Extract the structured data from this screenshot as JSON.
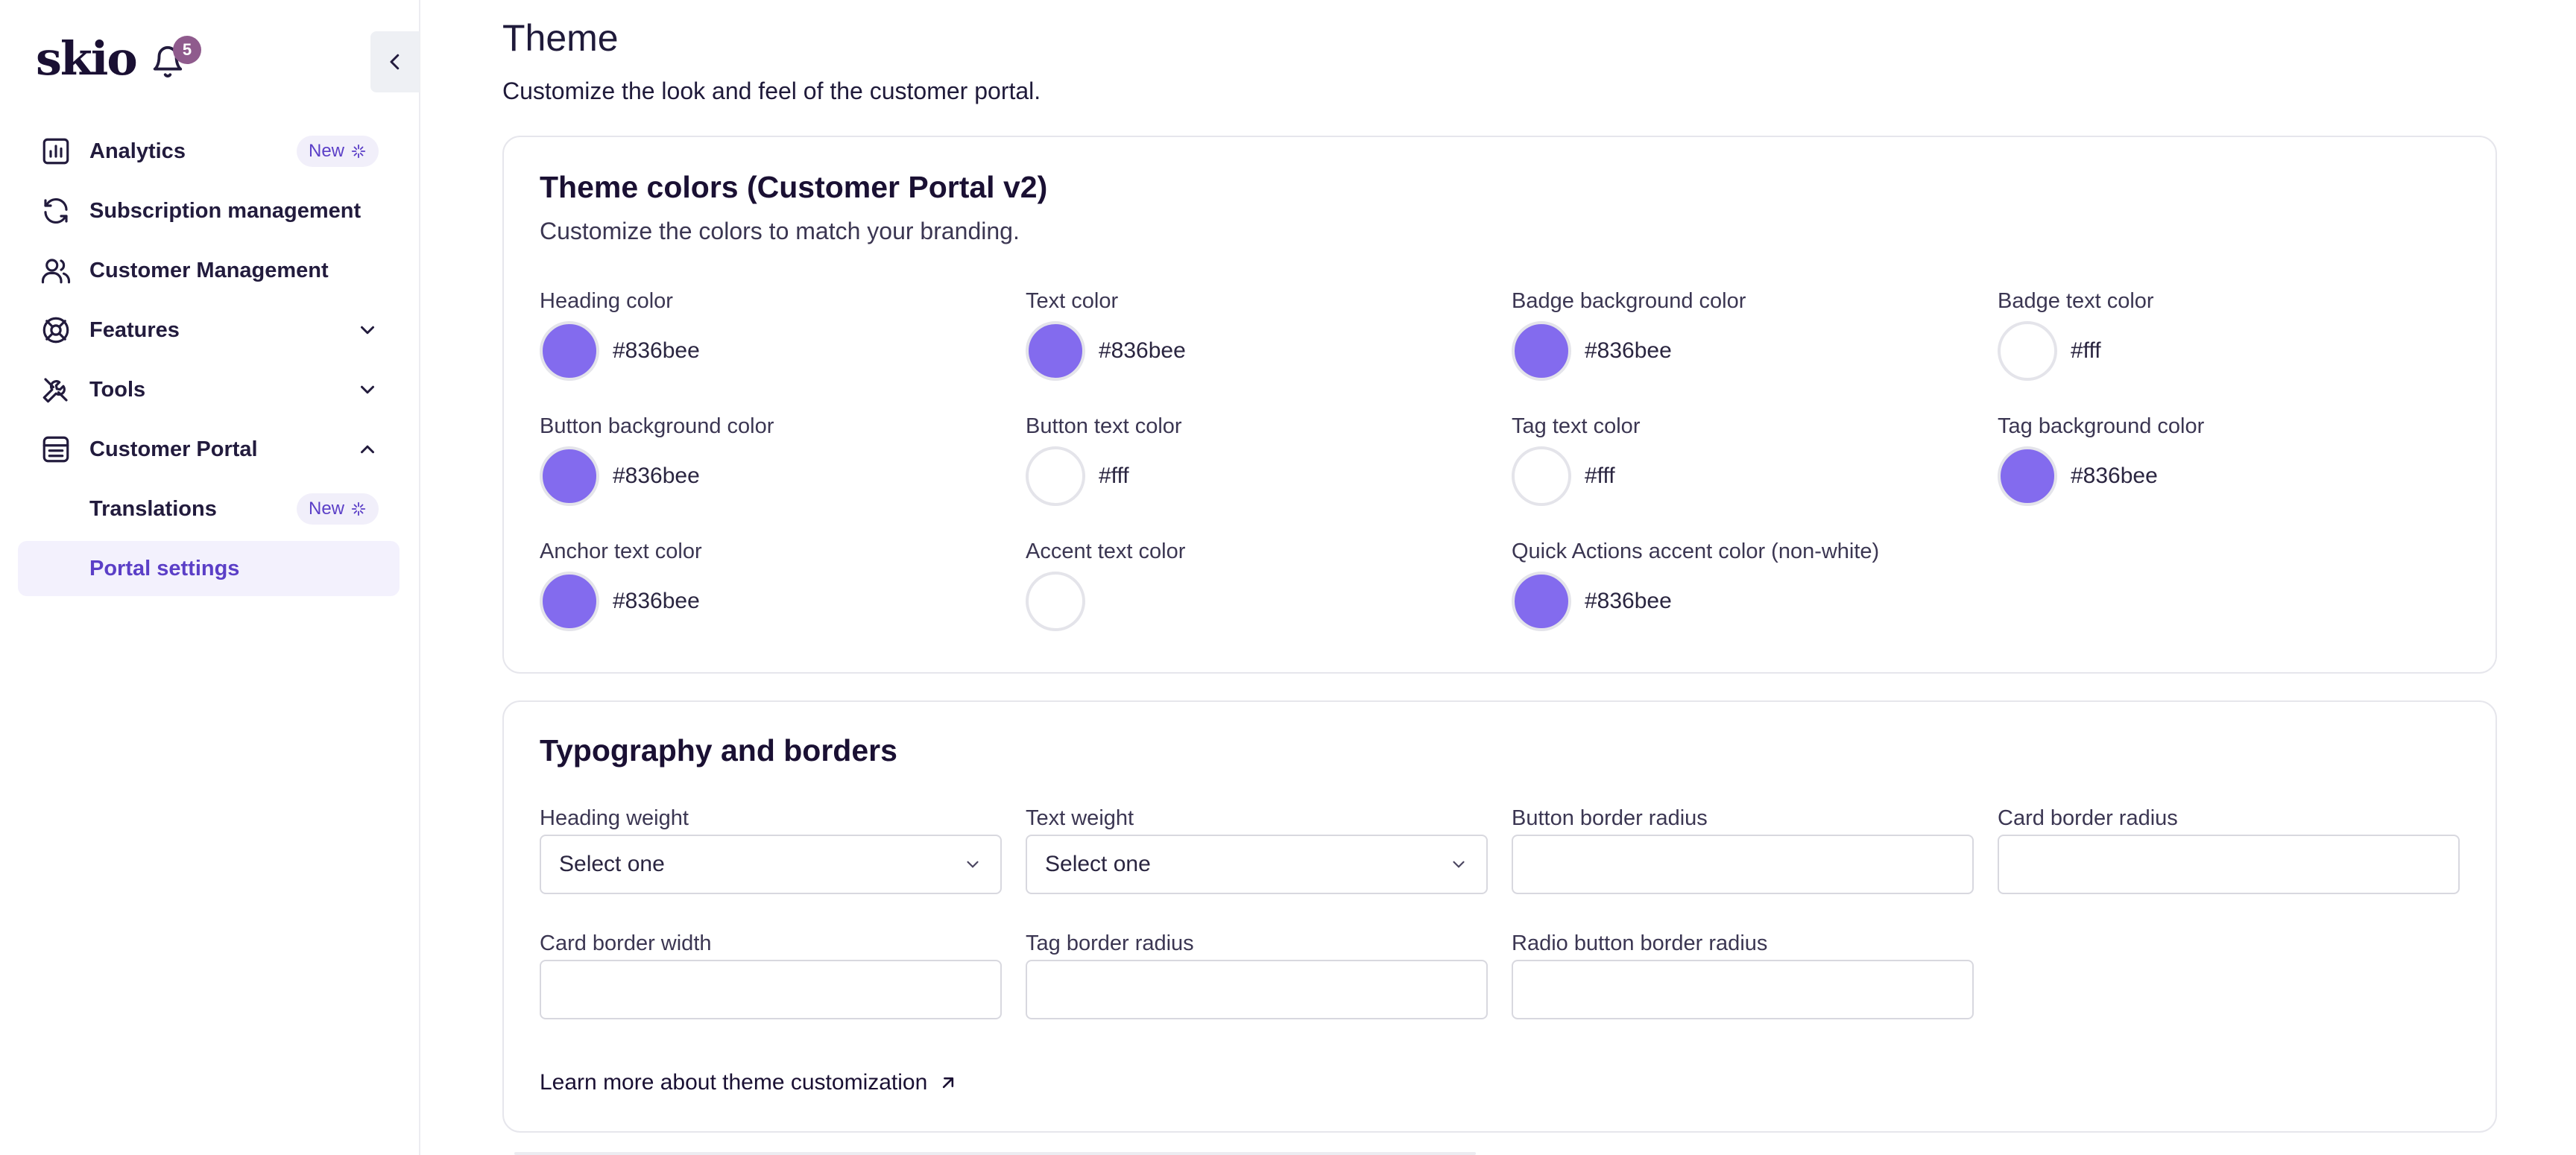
{
  "brand": {
    "logo_text": "skio",
    "notification_count": "5",
    "accent": "#836bee"
  },
  "sidebar": {
    "items": [
      {
        "label": "Analytics",
        "badge": "New",
        "icon": "chart-icon"
      },
      {
        "label": "Subscription management",
        "icon": "refresh-icon"
      },
      {
        "label": "Customer Management",
        "icon": "users-icon"
      },
      {
        "label": "Features",
        "icon": "features-icon",
        "expandable": true
      },
      {
        "label": "Tools",
        "icon": "tools-icon",
        "expandable": true
      },
      {
        "label": "Customer Portal",
        "icon": "portal-icon",
        "expanded": true
      }
    ],
    "sub_items": [
      {
        "label": "Translations",
        "badge": "New"
      },
      {
        "label": "Portal settings",
        "active": true
      }
    ]
  },
  "page": {
    "title": "Theme",
    "subtitle": "Customize the look and feel of the customer portal."
  },
  "theme_colors": {
    "title": "Theme colors (Customer Portal v2)",
    "subtitle": "Customize the colors to match your branding.",
    "fields": [
      {
        "label": "Heading color",
        "value": "#836bee",
        "swatch": "#836bee"
      },
      {
        "label": "Text color",
        "value": "#836bee",
        "swatch": "#836bee"
      },
      {
        "label": "Badge background color",
        "value": "#836bee",
        "swatch": "#836bee"
      },
      {
        "label": "Badge text color",
        "value": "#fff",
        "swatch": "#ffffff"
      },
      {
        "label": "Button background color",
        "value": "#836bee",
        "swatch": "#836bee"
      },
      {
        "label": "Button text color",
        "value": "#fff",
        "swatch": "#ffffff"
      },
      {
        "label": "Tag text color",
        "value": "#fff",
        "swatch": "#ffffff"
      },
      {
        "label": "Tag background color",
        "value": "#836bee",
        "swatch": "#836bee"
      },
      {
        "label": "Anchor text color",
        "value": "#836bee",
        "swatch": "#836bee"
      },
      {
        "label": "Accent text color",
        "value": "",
        "swatch": "#ffffff"
      },
      {
        "label": "Quick Actions accent color (non-white)",
        "value": "#836bee",
        "swatch": "#836bee"
      }
    ]
  },
  "typography": {
    "title": "Typography and borders",
    "fields": [
      {
        "label": "Heading weight",
        "type": "select",
        "value": "Select one"
      },
      {
        "label": "Text weight",
        "type": "select",
        "value": "Select one"
      },
      {
        "label": "Button border radius",
        "type": "input",
        "value": ""
      },
      {
        "label": "Card border radius",
        "type": "input",
        "value": ""
      },
      {
        "label": "Card border width",
        "type": "input",
        "value": ""
      },
      {
        "label": "Tag border radius",
        "type": "input",
        "value": ""
      },
      {
        "label": "Radio button border radius",
        "type": "input",
        "value": ""
      }
    ],
    "learn_more": "Learn more about theme customization"
  }
}
